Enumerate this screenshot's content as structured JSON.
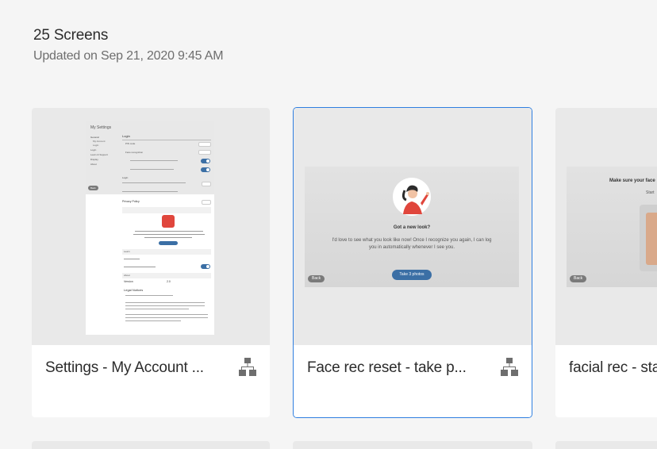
{
  "header": {
    "screen_count": "25 Screens",
    "updated": "Updated on Sep 21, 2020 9:45 AM"
  },
  "cards": [
    {
      "title": "Settings - My Account ...",
      "icon": "flow-icon",
      "preview": {
        "heading": "My Settings",
        "nav": [
          "General",
          "My Account",
          "Login",
          "Login",
          "Learn & Support",
          "Display",
          "About"
        ],
        "section_login": "Login",
        "row_pin": "PIN code",
        "row_face": "Face recognition",
        "section_face": "Login",
        "row_privacy": "Privacy Policy",
        "section_special": "Special Offer",
        "section_learn": "Learn",
        "section_about": "About",
        "row_version": "Version",
        "version_value": "2.0",
        "legal_title": "Legal Notices",
        "back": "Back"
      }
    },
    {
      "title": "Face rec reset - take p...",
      "icon": "flow-icon",
      "preview": {
        "heading": "Got a new look?",
        "body_line1": "I'd love to see what you look like now! Once I recognize you again, I can log",
        "body_line2": "you in automatically whenever I see you.",
        "button": "Take 3 photos",
        "back": "Back"
      }
    },
    {
      "title": "facial rec - sta",
      "preview": {
        "heading": "Make sure your face",
        "subtext": "Start",
        "back": "Back"
      }
    }
  ],
  "colors": {
    "selected_border": "#2f7fe0",
    "button_blue": "#3b6fa5",
    "accent_red": "#e0463c"
  }
}
